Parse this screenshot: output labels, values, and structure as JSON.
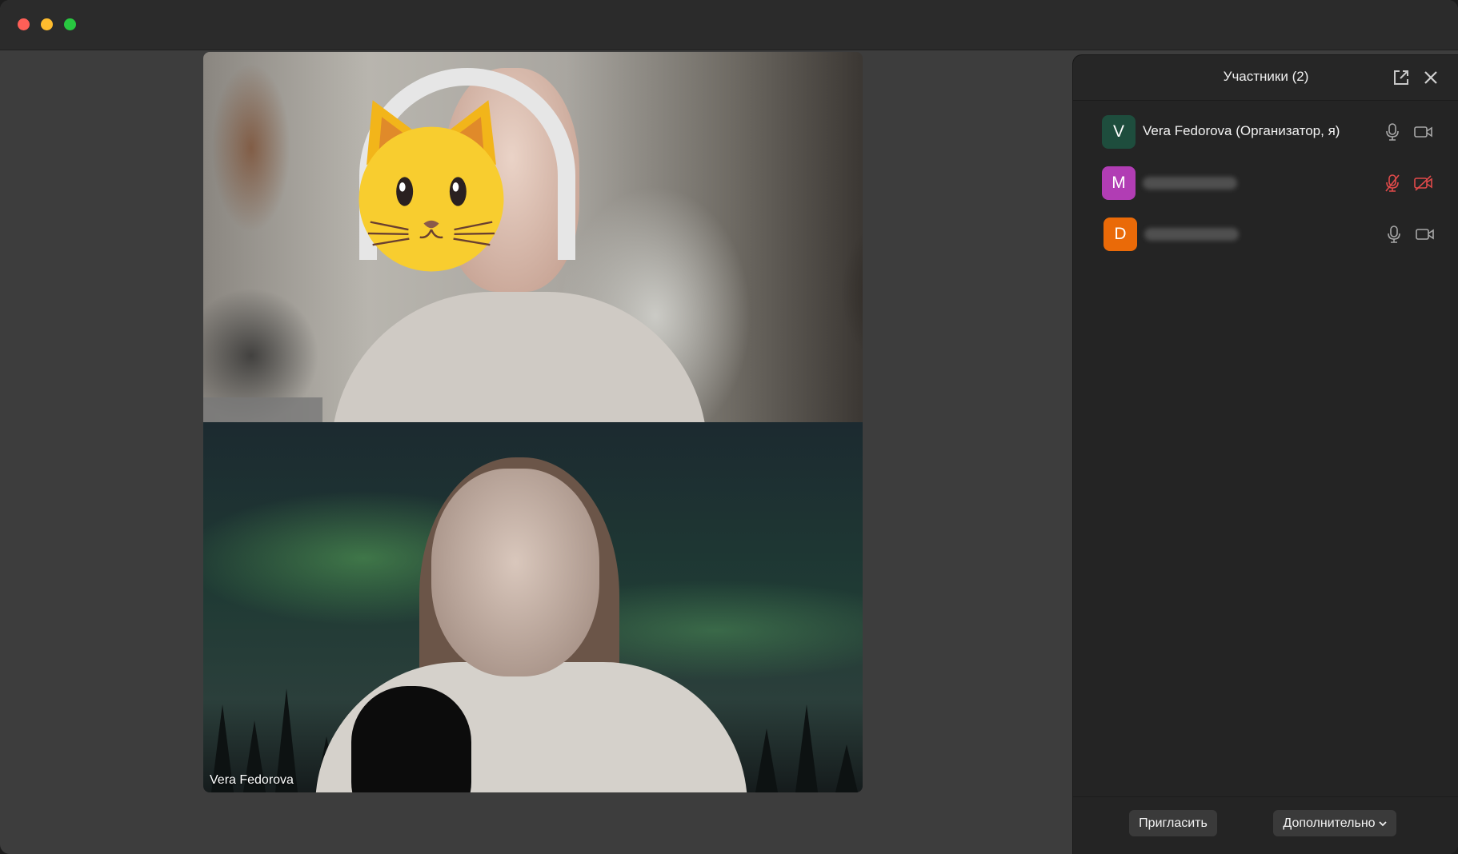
{
  "app": {
    "window": "video-conference"
  },
  "video_tiles": [
    {
      "id": "remote",
      "name_badge": ""
    },
    {
      "id": "self",
      "name": "Vera Fedorova"
    }
  ],
  "participants_panel": {
    "title": "Участники (2)",
    "participants": [
      {
        "initial": "V",
        "avatar_color": "#1e4d3d",
        "name": "Vera Fedorova (Организатор, я)",
        "mic_muted": false,
        "camera_off": false
      },
      {
        "initial": "M",
        "avatar_color": "#b13db4",
        "name": "",
        "mic_muted": true,
        "camera_off": true
      },
      {
        "initial": "D",
        "avatar_color": "#ea6a08",
        "name": "",
        "mic_muted": false,
        "camera_off": false
      }
    ],
    "footer": {
      "invite_label": "Пригласить",
      "more_label": "Дополнительно"
    }
  },
  "colors": {
    "muted": "#e04a4a",
    "icon": "#a8a8a8"
  }
}
